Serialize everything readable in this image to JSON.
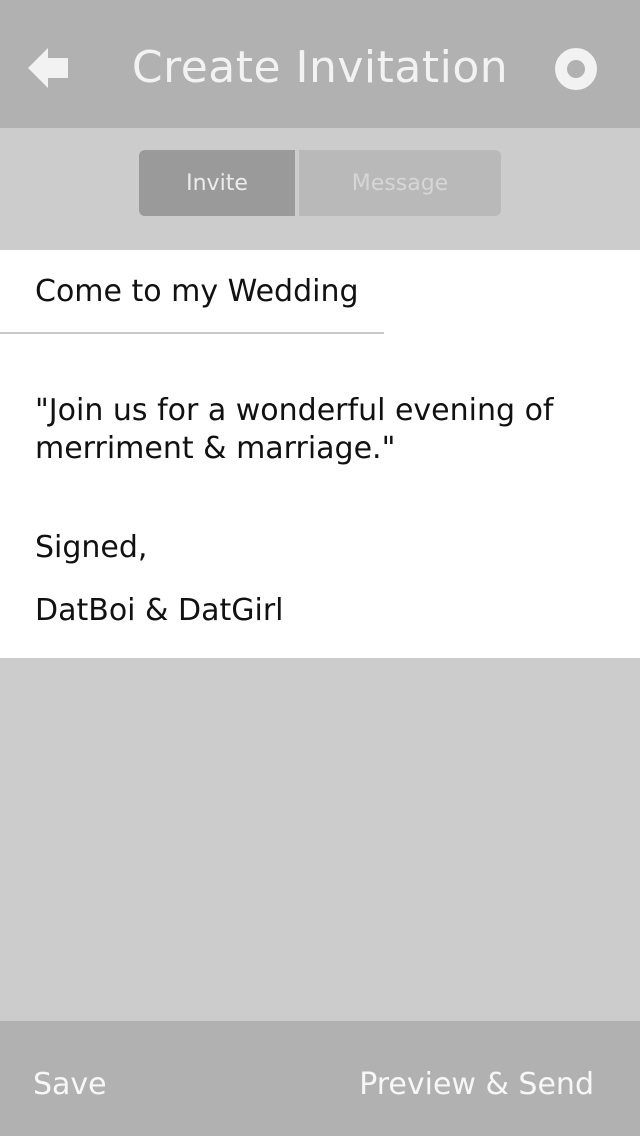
{
  "header": {
    "title": "Create Invitation",
    "back_icon": "arrow-left-icon",
    "settings_icon": "ring-icon"
  },
  "tabs": [
    {
      "label": "Invite",
      "active": true
    },
    {
      "label": "Message",
      "active": false
    }
  ],
  "invitation": {
    "subject": "Come to my Wedding",
    "body": "\"Join us for a wonderful evening of merriment & marriage.\"",
    "signed": "Signed,",
    "names": "DatBoi & DatGirl"
  },
  "footer": {
    "save_label": "Save",
    "send_label": "Preview & Send"
  },
  "colors": {
    "header_bg": "#b1b1b1",
    "page_bg": "#cccccc",
    "active_tab": "#9a9a9a",
    "inactive_tab": "#b9b9b9"
  }
}
